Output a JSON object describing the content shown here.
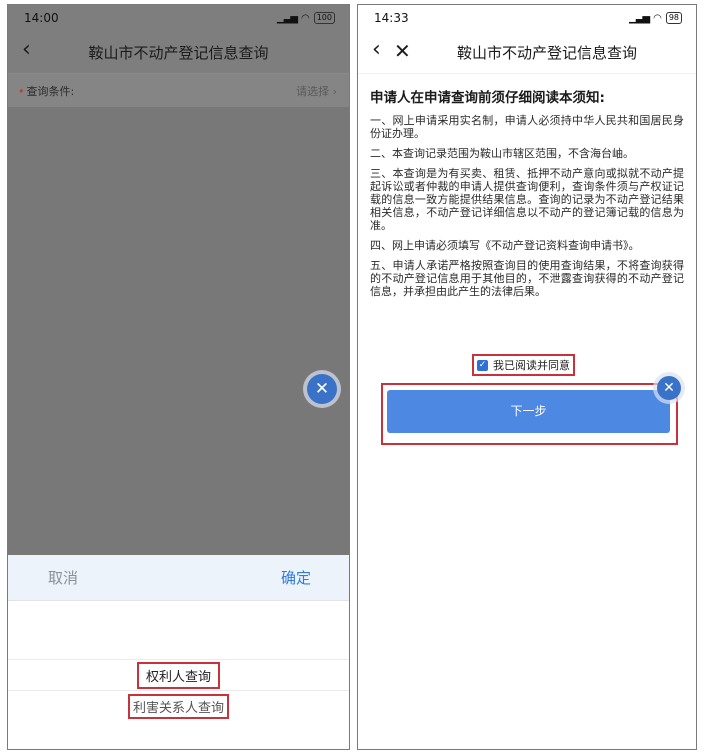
{
  "left": {
    "status": {
      "time": "14:00",
      "signal": "⁵ᴳ",
      "battery": "100"
    },
    "nav": {
      "title": "鞍山市不动产登记信息查询"
    },
    "query": {
      "label": "查询条件:",
      "placeholder": "请选择"
    },
    "picker": {
      "cancel": "取消",
      "confirm": "确定",
      "options": [
        "权利人查询",
        "利害关系人查询"
      ]
    }
  },
  "right": {
    "status": {
      "time": "14:33",
      "signal": "⁵ᴳ",
      "battery": "98"
    },
    "nav": {
      "title": "鞍山市不动产登记信息查询"
    },
    "notice": {
      "heading": "申请人在申请查询前须仔细阅读本须知:",
      "items": [
        "一、网上申请采用实名制，申请人必须持中华人民共和国居民身份证办理。",
        "二、本查询记录范围为鞍山市辖区范围，不含海台岫。",
        "三、本查询是为有买卖、租赁、抵押不动产意向或拟就不动产提起诉讼或者仲裁的申请人提供查询便利，查询条件须与产权证记载的信息一致方能提供结果信息。查询的记录为不动产登记结果相关信息，不动产登记详细信息以不动产的登记簿记载的信息为准。",
        "四、网上申请必须填写《不动产登记资料查询申请书》。",
        "五、申请人承诺严格按照查询目的使用查询结果，不将查询获得的不动产登记信息用于其他目的，不泄露查询获得的不动产登记信息，并承担由此产生的法律后果。"
      ]
    },
    "agree_label": "我已阅读并同意",
    "next_label": "下一步"
  },
  "colors": {
    "accent": "#2f7bd9",
    "button": "#4d88e3",
    "highlight": "#c8323c"
  }
}
